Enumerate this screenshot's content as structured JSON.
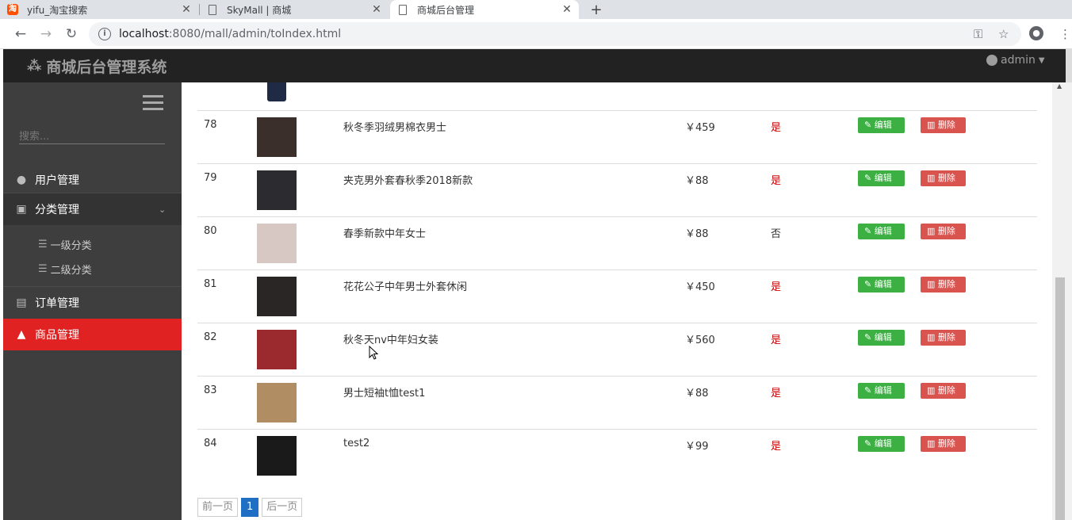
{
  "browser": {
    "tabs": [
      {
        "title": "yifu_淘宝搜索",
        "favicon": "taobao-icon",
        "active": false
      },
      {
        "title": "SkyMall | 商城",
        "favicon": "page-icon",
        "active": false
      },
      {
        "title": "商城后台管理",
        "favicon": "page-icon",
        "active": true
      }
    ],
    "new_tab": "+",
    "url_host": "localhost",
    "url_rest": ":8080/mall/admin/toIndex.html"
  },
  "header": {
    "title": "商城后台管理系统",
    "user": "admin"
  },
  "sidebar": {
    "search_placeholder": "搜索...",
    "items": [
      {
        "label": "用户管理",
        "icon": "user-circle-icon"
      },
      {
        "label": "分类管理",
        "icon": "category-icon"
      },
      {
        "label": "订单管理",
        "icon": "file-icon"
      },
      {
        "label": "商品管理",
        "icon": "shopping-bag-icon"
      }
    ],
    "subitems": [
      {
        "label": "一级分类",
        "icon": "list-icon"
      },
      {
        "label": "二级分类",
        "icon": "list-icon"
      }
    ]
  },
  "products": [
    {
      "id": "78",
      "name": "秋冬季羽绒男棉衣男士",
      "price": "￥459",
      "hot": "是",
      "img_color": "#3a2f2a"
    },
    {
      "id": "79",
      "name": "夹克男外套春秋季2018新款",
      "price": "￥88",
      "hot": "是",
      "img_color": "#2c2c30"
    },
    {
      "id": "80",
      "name": "春季新款中年女士",
      "price": "￥88",
      "hot": "否",
      "img_color": "#d8c8c4"
    },
    {
      "id": "81",
      "name": "花花公子中年男士外套休闲",
      "price": "￥450",
      "hot": "是",
      "img_color": "#2a2626"
    },
    {
      "id": "82",
      "name": "秋冬天nv中年妇女装",
      "price": "￥560",
      "hot": "是",
      "img_color": "#9b2a2e"
    },
    {
      "id": "83",
      "name": "男士短袖t恤test1",
      "price": "￥88",
      "hot": "是",
      "img_color": "#b08d63"
    },
    {
      "id": "84",
      "name": "test2",
      "price": "￥99",
      "hot": "是",
      "img_color": "#1a1a1a"
    }
  ],
  "actions": {
    "edit": "编辑",
    "delete": "删除"
  },
  "pager": {
    "prev": "前一页",
    "current": "1",
    "next": "后一页"
  }
}
